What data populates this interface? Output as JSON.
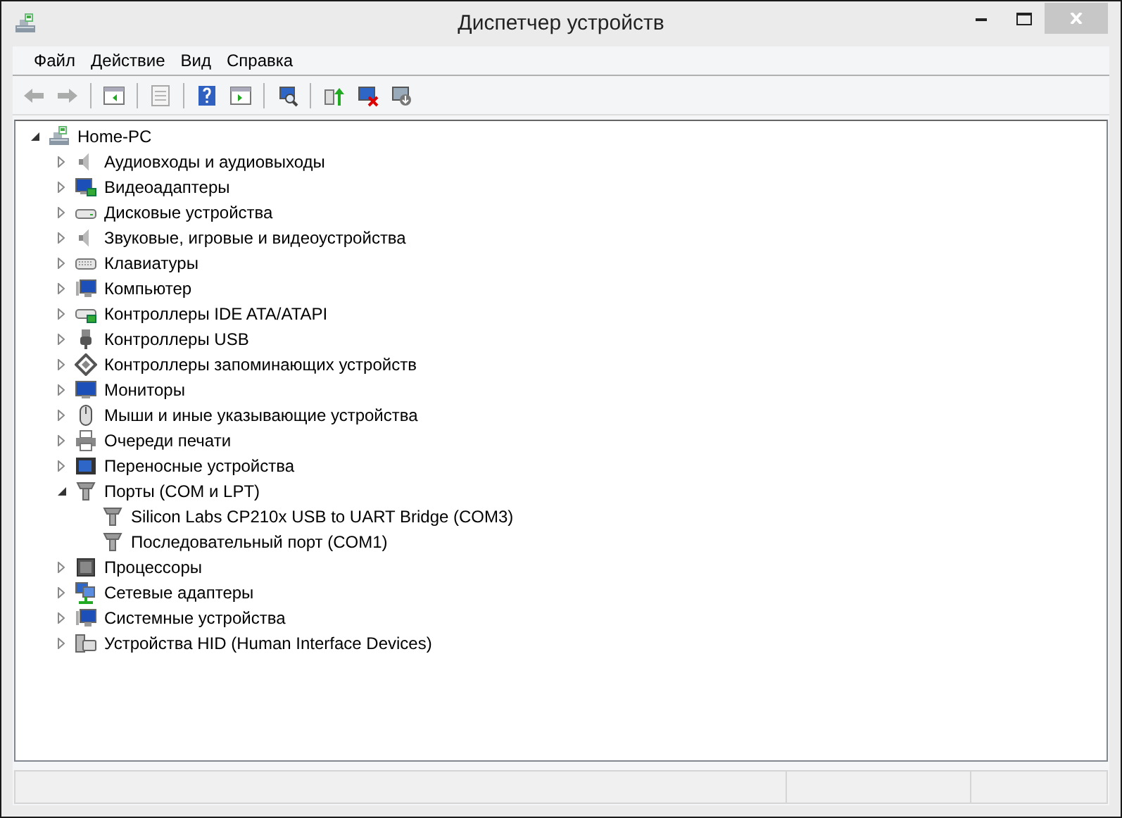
{
  "window": {
    "title": "Диспетчер устройств"
  },
  "menu": [
    "Файл",
    "Действие",
    "Вид",
    "Справка"
  ],
  "toolbar": [
    {
      "kind": "back",
      "disabled": true
    },
    {
      "kind": "forward",
      "disabled": true
    },
    {
      "kind": "sep"
    },
    {
      "kind": "console",
      "disabled": false
    },
    {
      "kind": "sep"
    },
    {
      "kind": "properties",
      "disabled": true
    },
    {
      "kind": "sep"
    },
    {
      "kind": "help",
      "disabled": false
    },
    {
      "kind": "pane",
      "disabled": false
    },
    {
      "kind": "sep"
    },
    {
      "kind": "scan",
      "disabled": false
    },
    {
      "kind": "sep"
    },
    {
      "kind": "update",
      "disabled": false
    },
    {
      "kind": "uninstall",
      "disabled": false
    },
    {
      "kind": "install",
      "disabled": false
    }
  ],
  "tree": {
    "label": "Home-PC",
    "expanded": true,
    "children": [
      {
        "label": "Аудиовходы и аудиовыходы",
        "expanded": false
      },
      {
        "label": "Видеоадаптеры",
        "expanded": false
      },
      {
        "label": "Дисковые устройства",
        "expanded": false
      },
      {
        "label": "Звуковые, игровые и видеоустройства",
        "expanded": false
      },
      {
        "label": "Клавиатуры",
        "expanded": false
      },
      {
        "label": "Компьютер",
        "expanded": false
      },
      {
        "label": "Контроллеры IDE ATA/ATAPI",
        "expanded": false
      },
      {
        "label": "Контроллеры USB",
        "expanded": false
      },
      {
        "label": "Контроллеры запоминающих устройств",
        "expanded": false
      },
      {
        "label": "Мониторы",
        "expanded": false
      },
      {
        "label": "Мыши и иные указывающие устройства",
        "expanded": false
      },
      {
        "label": "Очереди печати",
        "expanded": false
      },
      {
        "label": "Переносные устройства",
        "expanded": false
      },
      {
        "label": "Порты (COM и LPT)",
        "expanded": true,
        "children": [
          {
            "label": "Silicon Labs CP210x USB to UART Bridge (COM3)"
          },
          {
            "label": "Последовательный порт (COM1)"
          }
        ]
      },
      {
        "label": "Процессоры",
        "expanded": false
      },
      {
        "label": "Сетевые адаптеры",
        "expanded": false
      },
      {
        "label": "Системные устройства",
        "expanded": false
      },
      {
        "label": "Устройства HID (Human Interface Devices)",
        "expanded": false
      }
    ]
  }
}
